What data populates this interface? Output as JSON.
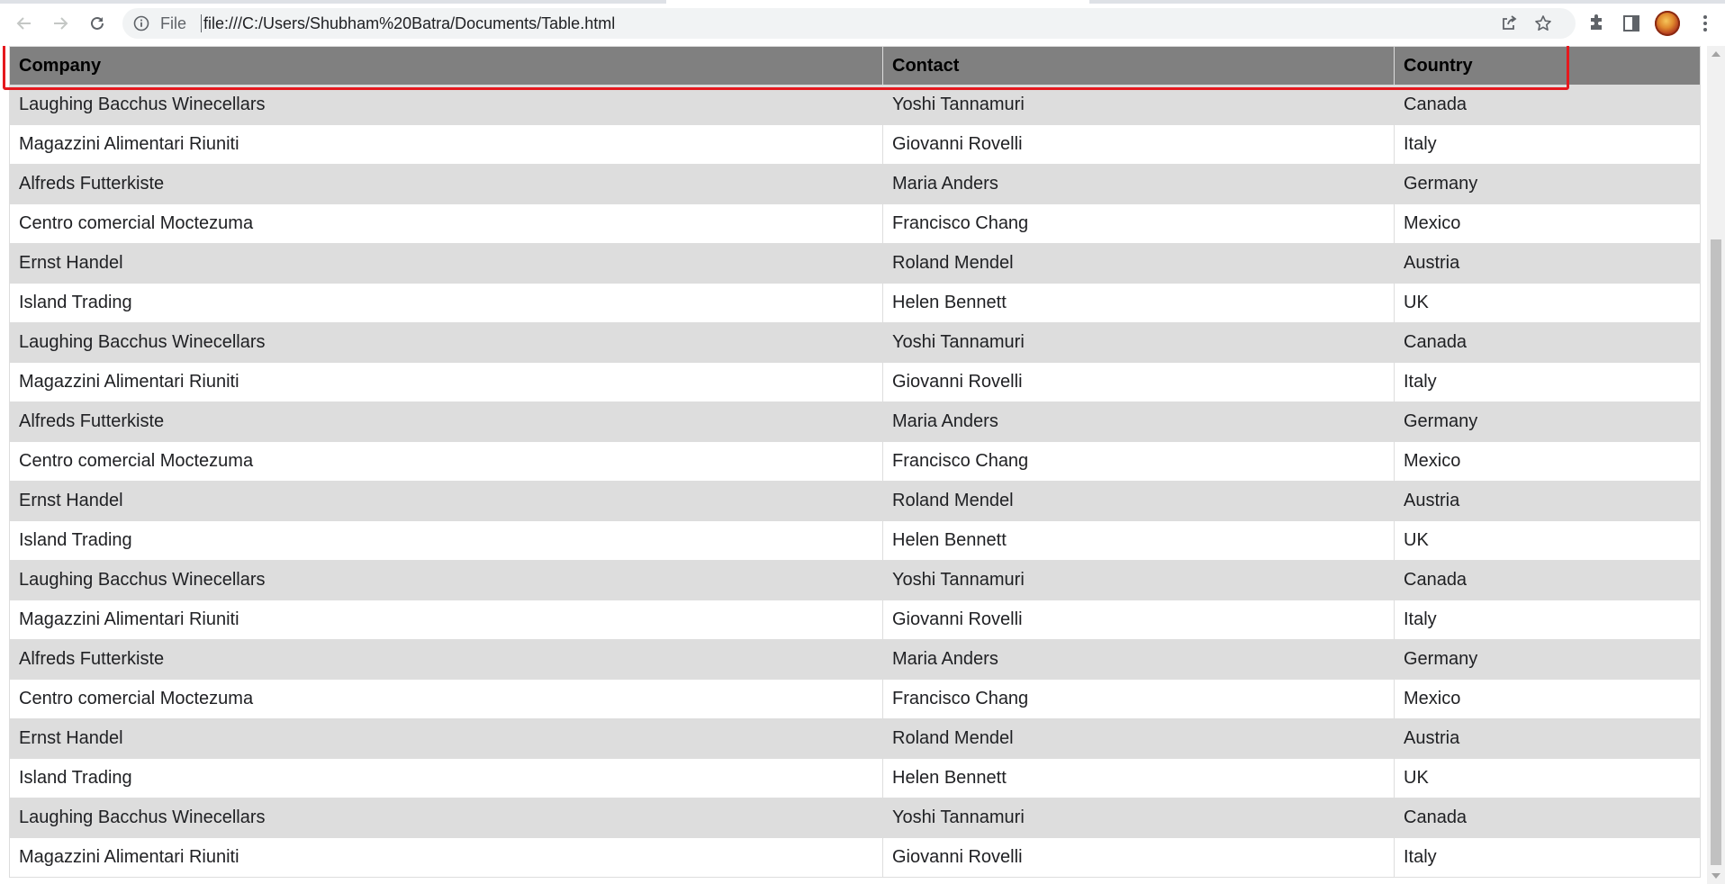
{
  "browser": {
    "url_scheme": "File",
    "url": "file:///C:/Users/Shubham%20Batra/Documents/Table.html",
    "icons": {
      "back": "back-arrow-icon",
      "forward": "forward-arrow-icon",
      "reload": "reload-icon",
      "site_info": "info-icon",
      "share": "share-icon",
      "bookmark": "star-icon",
      "extensions": "puzzle-icon",
      "side_panel": "side-panel-icon",
      "profile": "avatar",
      "menu": "more-vert-icon"
    }
  },
  "table": {
    "headers": [
      "Company",
      "Contact",
      "Country"
    ],
    "rows": [
      [
        "Laughing Bacchus Winecellars",
        "Yoshi Tannamuri",
        "Canada"
      ],
      [
        "Magazzini Alimentari Riuniti",
        "Giovanni Rovelli",
        "Italy"
      ],
      [
        "Alfreds Futterkiste",
        "Maria Anders",
        "Germany"
      ],
      [
        "Centro comercial Moctezuma",
        "Francisco Chang",
        "Mexico"
      ],
      [
        "Ernst Handel",
        "Roland Mendel",
        "Austria"
      ],
      [
        "Island Trading",
        "Helen Bennett",
        "UK"
      ],
      [
        "Laughing Bacchus Winecellars",
        "Yoshi Tannamuri",
        "Canada"
      ],
      [
        "Magazzini Alimentari Riuniti",
        "Giovanni Rovelli",
        "Italy"
      ],
      [
        "Alfreds Futterkiste",
        "Maria Anders",
        "Germany"
      ],
      [
        "Centro comercial Moctezuma",
        "Francisco Chang",
        "Mexico"
      ],
      [
        "Ernst Handel",
        "Roland Mendel",
        "Austria"
      ],
      [
        "Island Trading",
        "Helen Bennett",
        "UK"
      ],
      [
        "Laughing Bacchus Winecellars",
        "Yoshi Tannamuri",
        "Canada"
      ],
      [
        "Magazzini Alimentari Riuniti",
        "Giovanni Rovelli",
        "Italy"
      ],
      [
        "Alfreds Futterkiste",
        "Maria Anders",
        "Germany"
      ],
      [
        "Centro comercial Moctezuma",
        "Francisco Chang",
        "Mexico"
      ],
      [
        "Ernst Handel",
        "Roland Mendel",
        "Austria"
      ],
      [
        "Island Trading",
        "Helen Bennett",
        "UK"
      ],
      [
        "Laughing Bacchus Winecellars",
        "Yoshi Tannamuri",
        "Canada"
      ],
      [
        "Magazzini Alimentari Riuniti",
        "Giovanni Rovelli",
        "Italy"
      ]
    ]
  },
  "colors": {
    "header_bg": "#808080",
    "row_alt_bg": "#dddddd",
    "highlight_border": "#e5191e"
  }
}
